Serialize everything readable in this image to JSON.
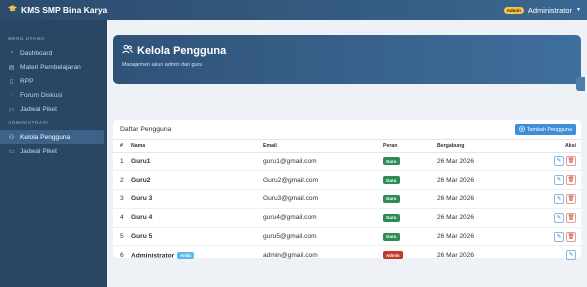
{
  "app": {
    "title": "KMS SMP Bina Karya",
    "icon": "graduation-cap-icon"
  },
  "topbar": {
    "role_badge": "Admin",
    "user": "Administrator"
  },
  "sidebar": {
    "section_main": "MENU UTAMA",
    "section_admin": "ADMINISTRASI",
    "items_main": [
      {
        "label": "Dashboard",
        "icon": "dashboard-icon"
      },
      {
        "label": "Materi Pembelajaran",
        "icon": "book-icon"
      },
      {
        "label": "RPP",
        "icon": "document-icon"
      },
      {
        "label": "Forum Diskusi",
        "icon": "chat-icon"
      },
      {
        "label": "Jadwal Piket",
        "icon": "calendar-icon"
      }
    ],
    "items_admin": [
      {
        "label": "Kelola Pengguna",
        "icon": "users-icon",
        "active": true
      },
      {
        "label": "Jadwal Piket",
        "icon": "calendar-icon"
      }
    ]
  },
  "hero": {
    "title": "Kelola Pengguna",
    "subtitle": "Manajemen akun admin dan guru"
  },
  "table": {
    "title": "Daftar Pengguna",
    "add_button": "Tambah Pengguna",
    "headers": {
      "no": "#",
      "name": "Nama",
      "email": "Email",
      "role": "Peran",
      "joined": "Bergabung",
      "action": "Aksi"
    },
    "rows": [
      {
        "no": "1",
        "name": "Guru1",
        "email": "guru1@gmail.com",
        "role": "Guru",
        "joined": "26 Mar 2026"
      },
      {
        "no": "2",
        "name": "Guru2",
        "email": "Guru2@gmail.com",
        "role": "Guru",
        "joined": "26 Mar 2026"
      },
      {
        "no": "3",
        "name": "Guru 3",
        "email": "Guru3@gmail.com",
        "role": "Guru",
        "joined": "26 Mar 2026"
      },
      {
        "no": "4",
        "name": "Guru 4",
        "email": "guru4@gmail.com",
        "role": "Guru",
        "joined": "26 Mar 2026"
      },
      {
        "no": "5",
        "name": "Guru 5",
        "email": "guru5@gmail.com",
        "role": "Guru",
        "joined": "26 Mar 2026"
      },
      {
        "no": "6",
        "name": "Administrator",
        "badge": "Anda",
        "email": "admin@gmail.com",
        "role": "Admin",
        "joined": "26 Mar 2026"
      }
    ]
  },
  "colors": {
    "sidebar": "#294664",
    "topbar": "#2c4b6b",
    "accent": "#3d8fd8",
    "guru": "#2e8b57",
    "admin": "#c0392b"
  }
}
